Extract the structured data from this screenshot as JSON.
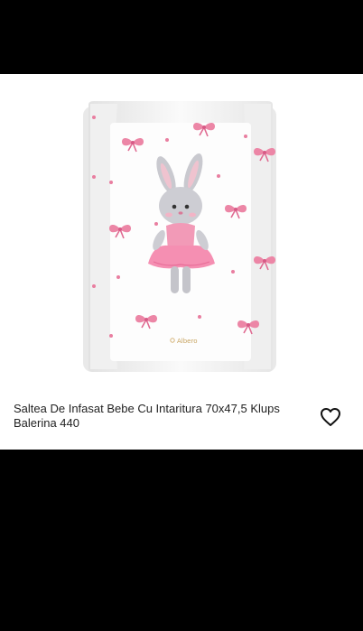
{
  "product": {
    "title": "Saltea De Infasat Bebe Cu Intaritura 70x47,5 Klups Balerina 440",
    "brand_mark": "Albero",
    "favorite_icon": "heart-outline-icon"
  },
  "colors": {
    "background": "#000000",
    "card": "#ffffff",
    "accent_pink": "#e7769a"
  }
}
